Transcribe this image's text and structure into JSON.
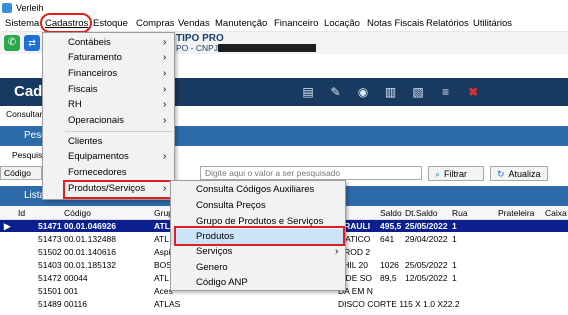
{
  "window": {
    "title": "Verleih"
  },
  "menubar": [
    "Sistema",
    "Cadastros",
    "Estoque",
    "Compras",
    "Vendas",
    "Manutenção",
    "Financeiro",
    "Locação",
    "Notas Fiscais",
    "Relatórios",
    "Utilitários"
  ],
  "company": {
    "name": "TIPO PRO",
    "cnpj_label": "PO - CNPJ :"
  },
  "header": {
    "title": "Cada"
  },
  "tab": {
    "label": "Consultar"
  },
  "pesquisa": {
    "bar_label": "Pesq",
    "label": "Pesquisa",
    "field_label": "Código",
    "placeholder": "Digite aqui o valor a ser pesquisado",
    "filter_button": "Filtrar",
    "refresh_button": "Atualiza"
  },
  "grid": {
    "bar_label": "Lista",
    "columns": [
      "Id",
      "Código",
      "Grup",
      "Saldo",
      "Dt.Saldo",
      "Rua",
      "Prateleira",
      "Caixa"
    ],
    "rows": [
      {
        "id": "51471",
        "codigo": "00.01.046926",
        "grupo": "ATL",
        "desc": "DRAULI",
        "saldo": "495,5",
        "dt": "25/05/2022",
        "rua": "1",
        "selected": true
      },
      {
        "id": "51473",
        "codigo": "00.01.132488",
        "grupo": "ATL",
        "desc": "MATICO",
        "saldo": "641",
        "dt": "29/04/2022",
        "rua": "1"
      },
      {
        "id": "51502",
        "codigo": "00.01.140616",
        "grupo": "Aspi",
        "desc": "NROD 2",
        "saldo": "",
        "dt": "",
        "rua": ""
      },
      {
        "id": "51403",
        "codigo": "00.01.185132",
        "grupo": "BOS",
        "desc": "THIL 20",
        "saldo": "1026",
        "dt": "25/05/2022",
        "rua": "1"
      },
      {
        "id": "51472",
        "codigo": "00044",
        "grupo": "ATL",
        "desc": "A DE SO",
        "saldo": "89,5",
        "dt": "12/05/2022",
        "rua": "1"
      },
      {
        "id": "51501",
        "codigo": "001",
        "grupo": "Aces",
        "desc": "DA EM N",
        "saldo": "",
        "dt": "",
        "rua": ""
      },
      {
        "id": "51489",
        "codigo": "00116",
        "grupo": "ATLAS",
        "desc": "DISCO  CORTE 115 X 1.0 X22.2",
        "saldo": "",
        "dt": "",
        "rua": ""
      }
    ]
  },
  "cadastros_menu": [
    {
      "label": "Contábeis",
      "submenu": true
    },
    {
      "label": "Faturamento",
      "submenu": true
    },
    {
      "label": "Financeiros",
      "submenu": true
    },
    {
      "label": "Fiscais",
      "submenu": true
    },
    {
      "label": "RH",
      "submenu": true
    },
    {
      "label": "Operacionais",
      "submenu": true
    },
    {
      "label": "Clientes",
      "submenu": false
    },
    {
      "label": "Equipamentos",
      "submenu": true
    },
    {
      "label": "Fornecedores",
      "submenu": false
    },
    {
      "label": "Produtos/Serviços",
      "submenu": true,
      "active": true
    }
  ],
  "produtos_submenu": [
    {
      "label": "Consulta Códigos Auxiliares"
    },
    {
      "label": "Consulta Preços"
    },
    {
      "label": "Grupo de Produtos e Serviços"
    },
    {
      "label": "Produtos",
      "active": true
    },
    {
      "label": "Serviços",
      "submenu": true
    },
    {
      "label": "Genero"
    },
    {
      "label": "Código ANP"
    }
  ],
  "colors": {
    "header": "#183a60",
    "bar": "#2d6aa9",
    "selection": "#0b1f8f",
    "menu_highlight": "#cce4f7",
    "annotation": "#e02020"
  }
}
